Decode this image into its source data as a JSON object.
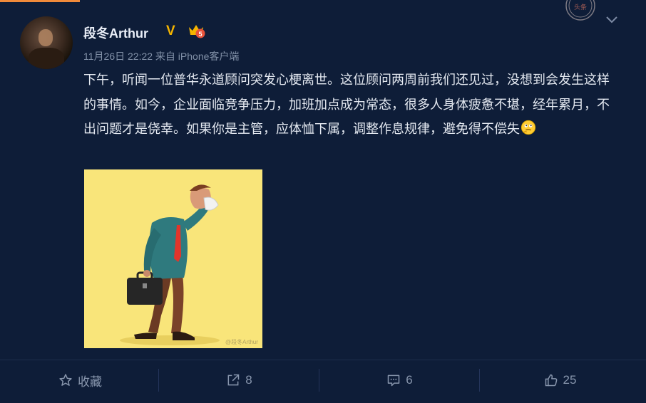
{
  "post": {
    "username": "段冬Arthur",
    "verified_badge": "V",
    "vip_badge_icon": "vip-crown-icon",
    "vip_level": "5",
    "stamp_text": "头条",
    "timestamp": "11月26日 22:22",
    "source": "来自 iPhone客户端",
    "content": "下午，听闻一位普华永道顾问突发心梗离世。这位顾问两周前我们还见过，没想到会发生这样的事情。如今，企业面临竞争压力，加班加点成为常态，很多人身体疲惫不堪，经年累月，不出问题才是侥幸。如果你是主管，应体恤下属，调整作息规律，避免得不偿失",
    "emoji_icon": "thinking-face-icon",
    "image_watermark": "@段冬Arthur"
  },
  "actions": {
    "favorite": {
      "label": "收藏",
      "icon": "star-icon"
    },
    "forward": {
      "count": "8",
      "icon": "share-icon"
    },
    "comment": {
      "count": "6",
      "icon": "comment-icon"
    },
    "like": {
      "count": "25",
      "icon": "thumbs-up-icon"
    }
  },
  "colors": {
    "background": "#0e1d38",
    "accent_orange": "#f08a3a",
    "verified_gold": "#f4b400",
    "image_bg": "#f9e57a"
  }
}
